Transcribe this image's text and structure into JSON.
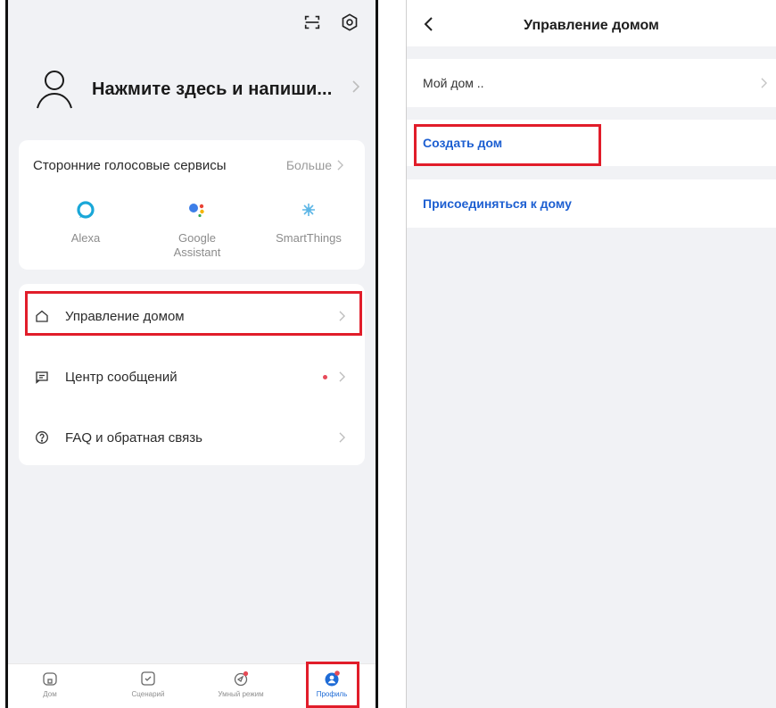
{
  "left": {
    "profile_name": "Нажмите здесь и напиши...",
    "voice_services": {
      "title": "Сторонние голосовые сервисы",
      "more": "Больше",
      "items": [
        {
          "label": "Alexa",
          "icon": "alexa-icon"
        },
        {
          "label": "Google Assistant",
          "label_line1": "Google",
          "label_line2": "Assistant",
          "icon": "google-assistant-icon"
        },
        {
          "label": "SmartThings",
          "icon": "smartthings-icon"
        }
      ]
    },
    "menu": [
      {
        "label": "Управление домом",
        "icon": "home-outline-icon"
      },
      {
        "label": "Центр сообщений",
        "icon": "message-icon",
        "unread_dot": true
      },
      {
        "label": "FAQ и обратная связь",
        "icon": "help-circle-icon"
      }
    ],
    "tabs": [
      {
        "label": "Дом",
        "icon": "home-tab-icon"
      },
      {
        "label": "Сценарий",
        "icon": "scene-tab-icon"
      },
      {
        "label": "Умный режим",
        "icon": "smart-tab-icon",
        "badge": true
      },
      {
        "label": "Профиль",
        "icon": "profile-tab-icon",
        "active": true,
        "badge": true
      }
    ]
  },
  "right": {
    "title": "Управление домом",
    "home_name": "Мой дом ..",
    "create_home": "Создать дом",
    "join_home": "Присоединяться к дому"
  },
  "colors": {
    "highlight": "#e11d2a",
    "link_blue": "#1d5fd1",
    "background": "#f1f2f5"
  }
}
